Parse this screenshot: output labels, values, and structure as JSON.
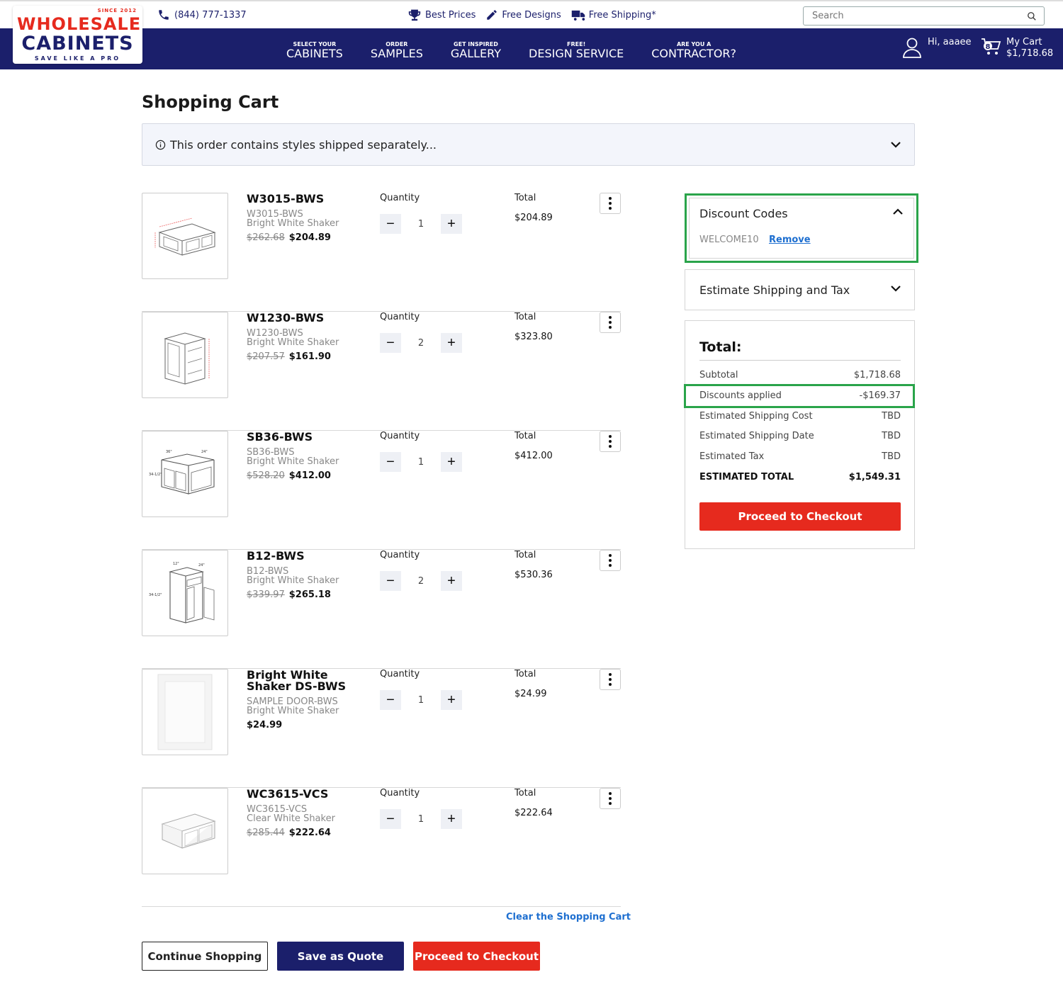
{
  "header": {
    "phone": "(844) 777-1337",
    "promos": [
      "Best Prices",
      "Free Designs",
      "Free Shipping*"
    ],
    "search_placeholder": "Search",
    "logo": {
      "since": "SINCE 2012",
      "line1": "WHOLESALE",
      "line2": "CABINETS",
      "tagline": "SAVE LIKE A PRO"
    },
    "nav": [
      {
        "small": "SELECT YOUR",
        "large": "CABINETS"
      },
      {
        "small": "ORDER",
        "large": "SAMPLES"
      },
      {
        "small": "GET INSPIRED",
        "large": "GALLERY"
      },
      {
        "small": "FREE!",
        "large": "DESIGN SERVICE"
      },
      {
        "small": "ARE YOU A",
        "large": "CONTRACTOR?"
      }
    ],
    "greeting": "Hi, aaaee",
    "cart": {
      "label": "My Cart",
      "amount": "$1,718.68",
      "count": "8"
    }
  },
  "page": {
    "title": "Shopping Cart",
    "notice": "This order contains styles shipped separately..."
  },
  "labels": {
    "quantity": "Quantity",
    "total": "Total"
  },
  "items": [
    {
      "name": "W3015-BWS",
      "sku": "W3015-BWS",
      "style": "Bright White Shaker",
      "old_price": "$262.68",
      "price": "$204.89",
      "qty": "1",
      "total": "$204.89"
    },
    {
      "name": "W1230-BWS",
      "sku": "W1230-BWS",
      "style": "Bright White Shaker",
      "old_price": "$207.57",
      "price": "$161.90",
      "qty": "2",
      "total": "$323.80"
    },
    {
      "name": "SB36-BWS",
      "sku": "SB36-BWS",
      "style": "Bright White Shaker",
      "old_price": "$528.20",
      "price": "$412.00",
      "qty": "1",
      "total": "$412.00"
    },
    {
      "name": "B12-BWS",
      "sku": "B12-BWS",
      "style": "Bright White Shaker",
      "old_price": "$339.97",
      "price": "$265.18",
      "qty": "2",
      "total": "$530.36"
    },
    {
      "name": "Bright White Shaker DS-BWS",
      "sku": "SAMPLE DOOR-BWS",
      "style": "Bright White Shaker",
      "old_price": "",
      "price": "$24.99",
      "qty": "1",
      "total": "$24.99"
    },
    {
      "name": "WC3615-VCS",
      "sku": "WC3615-VCS",
      "style": "Clear White Shaker",
      "old_price": "$285.44",
      "price": "$222.64",
      "qty": "1",
      "total": "$222.64"
    }
  ],
  "actions": {
    "clear_cart": "Clear the Shopping Cart",
    "continue": "Continue Shopping",
    "quote": "Save as Quote",
    "checkout": "Proceed to Checkout"
  },
  "summary": {
    "discount_title": "Discount Codes",
    "discount_code": "WELCOME10",
    "remove": "Remove",
    "shipping_title": "Estimate Shipping and Tax",
    "total_title": "Total:",
    "rows": [
      {
        "label": "Subtotal",
        "value": "$1,718.68"
      },
      {
        "label": "Discounts applied",
        "value": "-$169.37"
      },
      {
        "label": "Estimated Shipping Cost",
        "value": "TBD"
      },
      {
        "label": "Estimated Shipping Date",
        "value": "TBD"
      },
      {
        "label": "Estimated Tax",
        "value": "TBD"
      },
      {
        "label": "ESTIMATED TOTAL",
        "value": "$1,549.31"
      }
    ],
    "checkout": "Proceed to Checkout"
  },
  "colors": {
    "navy": "#1b1f6b",
    "red": "#e62a1e",
    "highlight": "#2aa44a",
    "link": "#1e6fd0"
  }
}
